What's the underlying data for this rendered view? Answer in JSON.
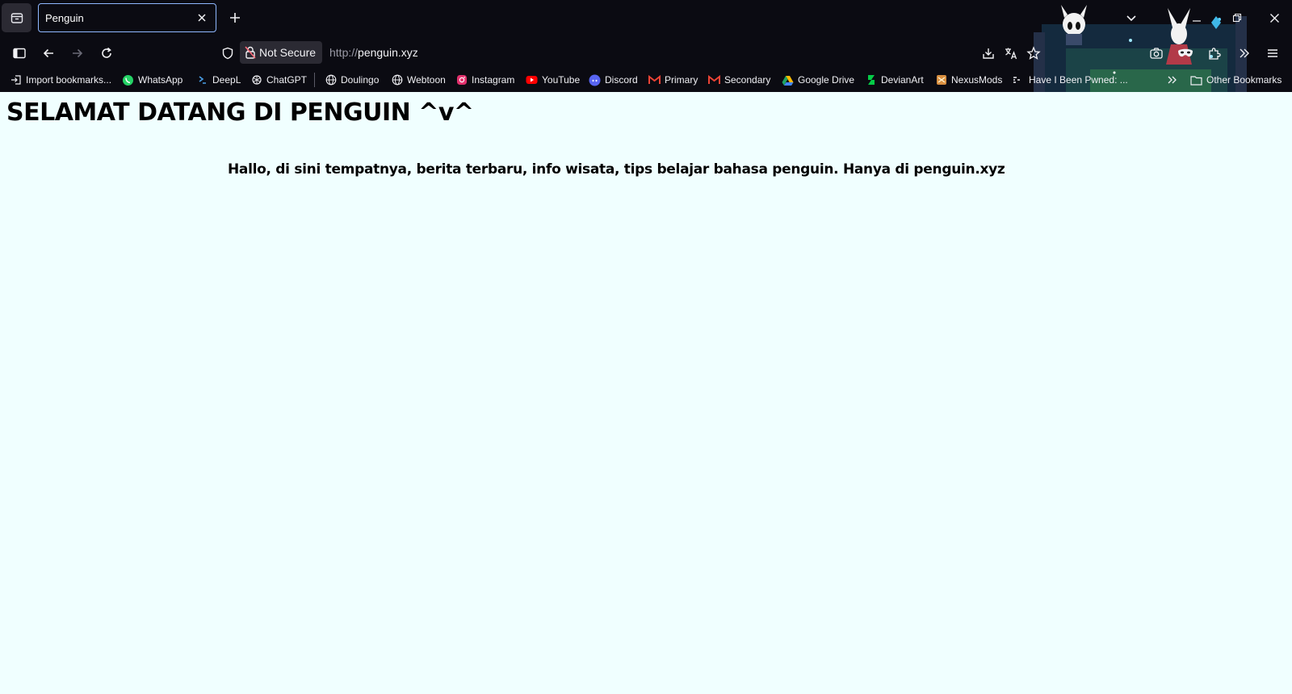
{
  "browser": {
    "tab": {
      "title": "Penguin"
    },
    "address": {
      "security_label": "Not Secure",
      "url_protocol": "http://",
      "url_host": "penguin.xyz"
    },
    "bookmarks": [
      {
        "label": "Import bookmarks...",
        "icon": "import-icon"
      },
      {
        "label": "WhatsApp",
        "icon": "whatsapp-icon",
        "color": "#25d366"
      },
      {
        "label": "DeepL",
        "icon": "deepl-icon",
        "color": "#1b4f8a"
      },
      {
        "label": "ChatGPT",
        "icon": "chatgpt-icon"
      },
      {
        "label": "Doulingo",
        "icon": "globe-icon"
      },
      {
        "label": "Webtoon",
        "icon": "globe-icon"
      },
      {
        "label": "Instagram",
        "icon": "instagram-icon",
        "color": "#e1306c"
      },
      {
        "label": "YouTube",
        "icon": "youtube-icon",
        "color": "#ff0000"
      },
      {
        "label": "Discord",
        "icon": "discord-icon",
        "color": "#5865f2"
      },
      {
        "label": "Primary",
        "icon": "gmail-icon",
        "color": "#ea4335"
      },
      {
        "label": "Secondary",
        "icon": "gmail-icon",
        "color": "#ea4335"
      },
      {
        "label": "Google Drive",
        "icon": "google-drive-icon",
        "color": "#1fa463"
      },
      {
        "label": "DevianArt",
        "icon": "deviantart-icon",
        "color": "#05cc47"
      },
      {
        "label": "NexusMods",
        "icon": "nexusmods-icon",
        "color": "#d98f40"
      },
      {
        "label": "Have I Been Pwned: ...",
        "icon": "hibp-icon"
      }
    ],
    "other_bookmarks_label": "Other Bookmarks"
  },
  "page": {
    "heading": "SELAMAT DATANG DI PENGUIN ^v^",
    "subheading": "Hallo, di sini tempatnya, berita terbaru, info wisata, tips belajar bahasa penguin. Hanya di penguin.xyz"
  },
  "colors": {
    "chrome_background": "#0b0b12",
    "page_background": "#f0ffff",
    "tab_border": "#8fb8ff"
  }
}
